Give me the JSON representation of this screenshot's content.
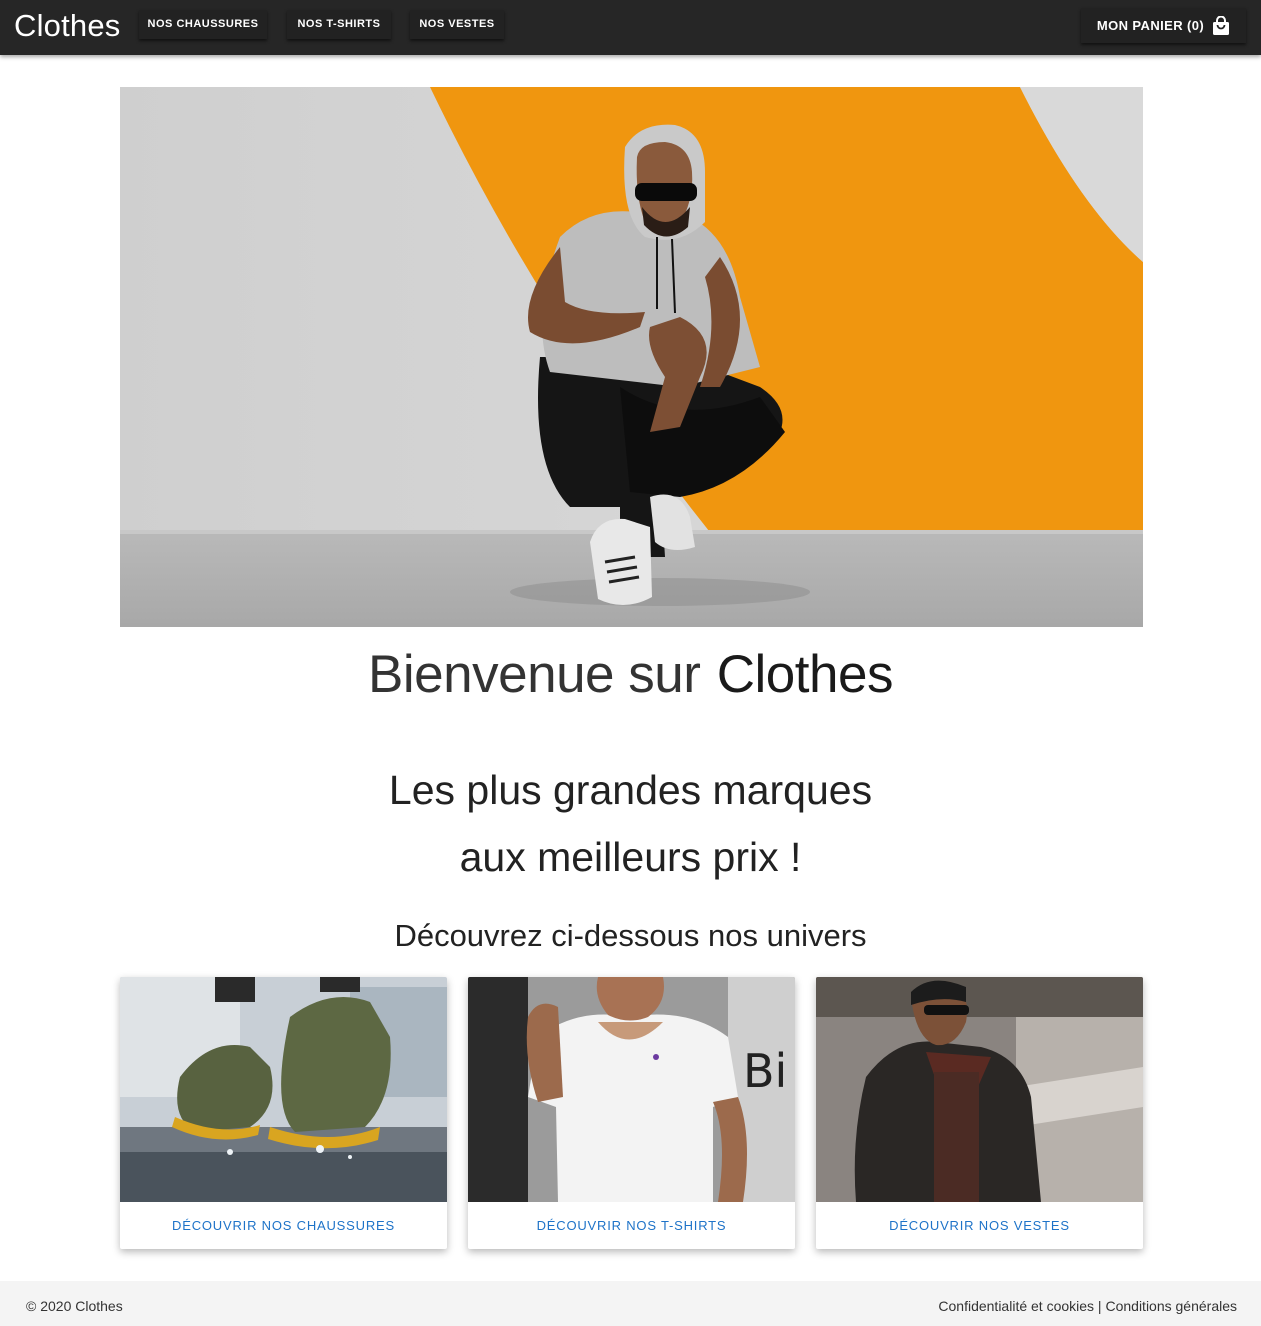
{
  "header": {
    "brand": "Clothes",
    "nav": [
      "NOS CHAUSSURES",
      "NOS T-SHIRTS",
      "NOS VESTES"
    ],
    "cart_label": "MON PANIER (0)",
    "cart_icon": "shopping-bag-icon"
  },
  "hero": {
    "welcome_prefix": "Bienvenue sur",
    "welcome_brand": "Clothes",
    "tagline_line1": "Les plus grandes marques",
    "tagline_line2": "aux meilleurs prix !",
    "discover": "Découvrez ci-dessous nos univers"
  },
  "cards": [
    {
      "link": "DÉCOUVRIR NOS CHAUSSURES"
    },
    {
      "link": "DÉCOUVRIR NOS T-SHIRTS"
    },
    {
      "link": "DÉCOUVRIR NOS VESTES"
    }
  ],
  "footer": {
    "copyright": "© 2020 Clothes",
    "privacy": "Confidentialité et cookies",
    "separator": " | ",
    "terms": "Conditions générales"
  },
  "colors": {
    "topbar": "#262626",
    "accent_link": "#1e73c8",
    "hero_orange": "#f0960f",
    "footer_bg": "#f4f4f4"
  }
}
